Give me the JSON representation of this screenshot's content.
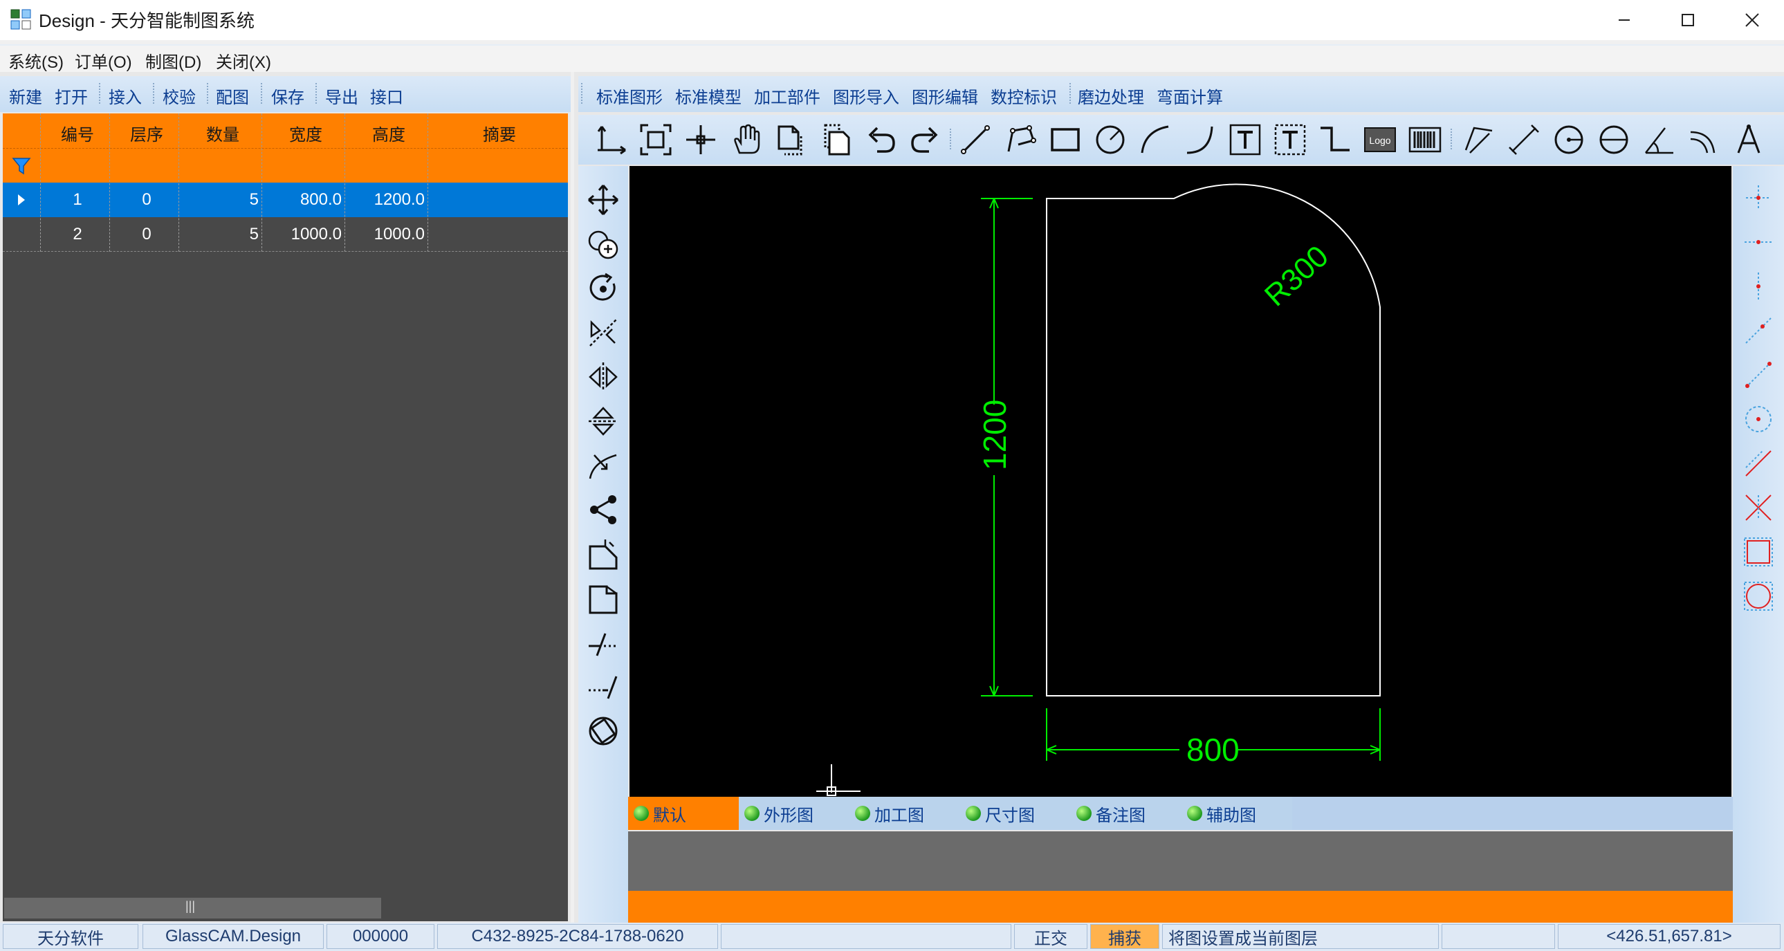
{
  "window": {
    "title": "Design - 天分智能制图系统",
    "minimize": "—",
    "maximize": "☐",
    "close": "✕"
  },
  "menu": [
    "系统(S)",
    "订单(O)",
    "制图(D)",
    "关闭(X)"
  ],
  "left_toolbar": [
    "新建",
    "打开",
    "接入",
    "校验",
    "配图",
    "保存",
    "导出",
    "接口"
  ],
  "grid": {
    "columns": [
      "编号",
      "层序",
      "数量",
      "宽度",
      "高度",
      "摘要"
    ],
    "rows": [
      {
        "id": "1",
        "layer": "0",
        "qty": "5",
        "width": "800.0",
        "height": "1200.0",
        "summary": "",
        "selected": true
      },
      {
        "id": "2",
        "layer": "0",
        "qty": "5",
        "width": "1000.0",
        "height": "1000.0",
        "summary": "",
        "selected": false
      }
    ],
    "scroll_grip": "|||"
  },
  "right_toolbar": [
    "标准图形",
    "标准模型",
    "加工部件",
    "图形导入",
    "图形编辑",
    "数控标识",
    "磨边处理",
    "弯面计算"
  ],
  "icon_toolbar": [
    "axis-origin-icon",
    "zoom-extents-icon",
    "crosshair-icon",
    "pan-hand-icon",
    "copy-icon",
    "paste-icon",
    "undo-icon",
    "redo-icon",
    "line-icon",
    "polyline-icon",
    "rectangle-icon",
    "circle-icon",
    "arc-icon",
    "curve-icon",
    "text-icon",
    "text-box-icon",
    "step-line-icon",
    "logo-icon",
    "barcode-icon",
    "dimension-aligned-icon",
    "dimension-linear-icon",
    "dimension-radius-icon",
    "dimension-diameter-icon",
    "dimension-angle-icon",
    "dimension-arc-icon",
    "compass-icon"
  ],
  "left_tools": [
    "move-icon",
    "copy-circles-icon",
    "rotate-icon",
    "mirror-icon",
    "flip-horizontal-icon",
    "flip-vertical-icon",
    "trim-icon",
    "share-nodes-icon",
    "edit-corner-icon",
    "edit-corner-2-icon",
    "extend-left-icon",
    "extend-right-icon",
    "rotate-view-icon"
  ],
  "snap_tools": [
    "snap-endpoint-icon",
    "snap-midpoint-icon",
    "snap-center-icon",
    "snap-nearest-icon",
    "snap-node-icon",
    "snap-circle-center-icon",
    "snap-perpendicular-icon",
    "snap-intersection-icon",
    "snap-rectangle-icon",
    "snap-circle-icon"
  ],
  "drawing": {
    "radius_label": "R300",
    "height_label": "1200",
    "width_label": "800",
    "shape_color": "#ffffff",
    "dimension_color": "#00ee00"
  },
  "layers": [
    {
      "label": "默认",
      "active": true
    },
    {
      "label": "外形图",
      "active": false
    },
    {
      "label": "加工图",
      "active": false
    },
    {
      "label": "尺寸图",
      "active": false
    },
    {
      "label": "备注图",
      "active": false
    },
    {
      "label": "辅助图",
      "active": false
    }
  ],
  "status": {
    "company": "天分软件",
    "product": "GlassCAM.Design",
    "code": "000000",
    "serial": "C432-8925-2C84-1788-0620",
    "ortho": "正交",
    "snap": "捕获",
    "hint": "将图设置成当前图层",
    "coords": "<426.51,657.81>"
  },
  "colors": {
    "accent_orange": "#ff8000",
    "selection_blue": "#0078d7",
    "toolbar_blue": "#c7ddf3"
  }
}
